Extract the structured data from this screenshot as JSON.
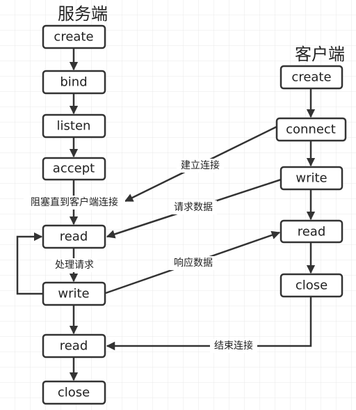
{
  "server": {
    "title": "服务端",
    "steps": [
      "create",
      "bind",
      "listen",
      "accept",
      "read",
      "write",
      "read",
      "close"
    ],
    "blocking_label": "阻塞直到客户端连接",
    "process_label": "处理请求"
  },
  "client": {
    "title": "客户端",
    "steps": [
      "create",
      "connect",
      "write",
      "read",
      "close"
    ]
  },
  "messages": {
    "connect": "建立连接",
    "request": "请求数据",
    "response": "响应数据",
    "end": "结束连接"
  },
  "colors": {
    "line": "#333333",
    "grid": "#e6e6e6"
  }
}
